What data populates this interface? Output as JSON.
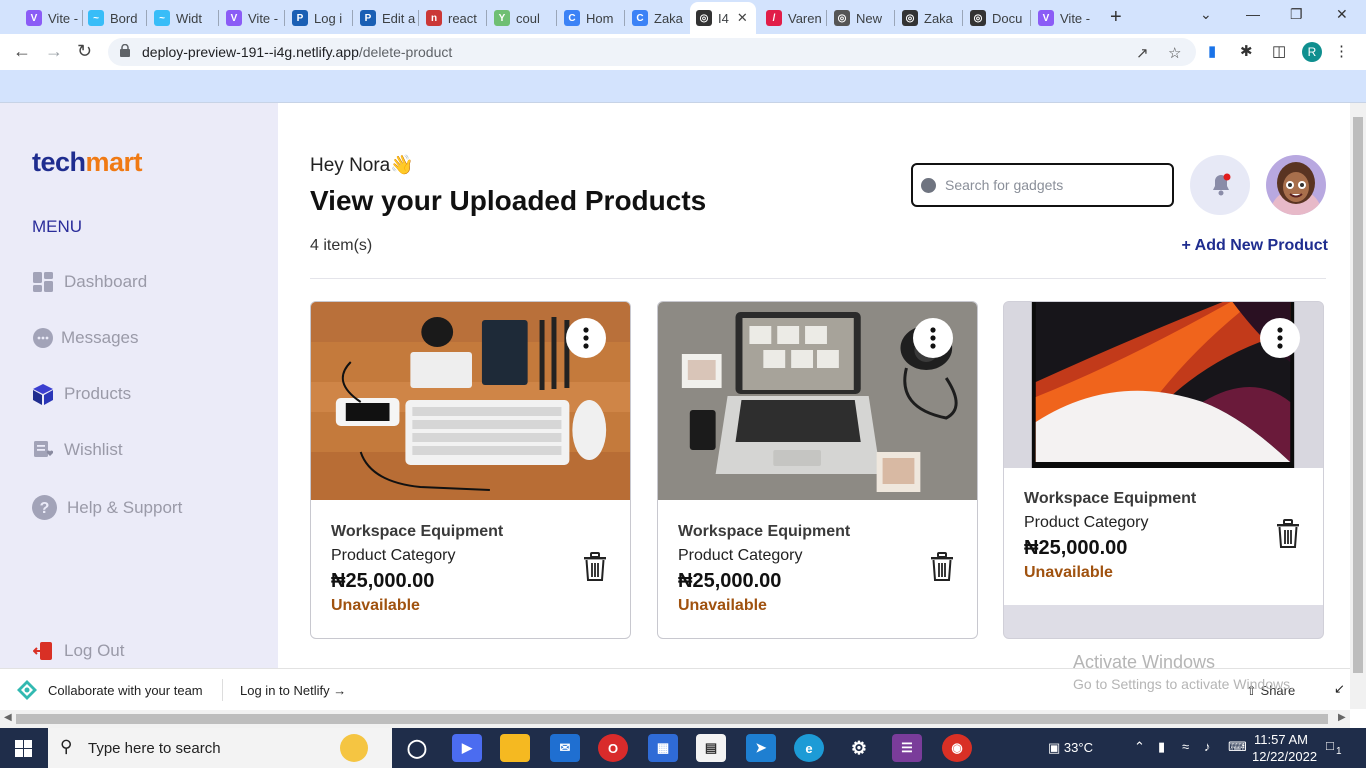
{
  "browser": {
    "tabs": [
      {
        "label": "Vite -",
        "color": "#8b5cf6",
        "glyph": "V"
      },
      {
        "label": "Bord",
        "color": "#38bdf8",
        "glyph": "~"
      },
      {
        "label": "Widt",
        "color": "#38bdf8",
        "glyph": "~"
      },
      {
        "label": "Vite -",
        "color": "#8b5cf6",
        "glyph": "V"
      },
      {
        "label": "Log i",
        "color": "#1a5fb4",
        "glyph": "P"
      },
      {
        "label": "Edit a",
        "color": "#1a5fb4",
        "glyph": "P"
      },
      {
        "label": "react",
        "color": "#cb3837",
        "glyph": "n"
      },
      {
        "label": "coul",
        "color": "#6fbf73",
        "glyph": "Y"
      },
      {
        "label": "Hom",
        "color": "#3b82f6",
        "glyph": "C"
      },
      {
        "label": "Zaka",
        "color": "#3b82f6",
        "glyph": "C"
      },
      {
        "label": "I4",
        "color": "#333333",
        "glyph": "◎",
        "active": true
      },
      {
        "label": "Varen",
        "color": "#e11d48",
        "glyph": "/"
      },
      {
        "label": "New",
        "color": "#555555",
        "glyph": "◎"
      },
      {
        "label": "Zaka",
        "color": "#333333",
        "glyph": "◎"
      },
      {
        "label": "Docu",
        "color": "#333333",
        "glyph": "◎"
      },
      {
        "label": "Vite -",
        "color": "#8b5cf6",
        "glyph": "V"
      }
    ],
    "url_host": "deploy-preview-191--i4g.netlify.app",
    "url_path": "/delete-product",
    "profile_initial": "R"
  },
  "sidebar": {
    "logo_part1": "tech",
    "logo_part2": "mart",
    "menu_label": "MENU",
    "items": [
      {
        "label": "Dashboard",
        "icon": "grid-icon"
      },
      {
        "label": "Messages",
        "icon": "chat-icon"
      },
      {
        "label": "Products",
        "icon": "cube-icon"
      },
      {
        "label": "Wishlist",
        "icon": "wishlist-icon"
      },
      {
        "label": "Help & Support",
        "icon": "help-icon"
      }
    ],
    "logout_label": "Log Out"
  },
  "header": {
    "greeting": "Hey Nora",
    "greeting_emoji": "👋",
    "title": "View your Uploaded Products",
    "item_count": "4 item(s)",
    "add_button": "+ Add New Product",
    "search_placeholder": "Search for gadgets"
  },
  "products": [
    {
      "name": "Workspace Equipment",
      "category": "Product Category",
      "price": "₦25,000.00",
      "status": "Unavailable",
      "image": "desk-flatlay"
    },
    {
      "name": "Workspace Equipment",
      "category": "Product Category",
      "price": "₦25,000.00",
      "status": "Unavailable",
      "image": "laptop-camera"
    },
    {
      "name": "Workspace Equipment",
      "category": "Product Category",
      "price": "₦25,000.00",
      "status": "Unavailable",
      "image": "macbook-wallpaper"
    }
  ],
  "netlify_bar": {
    "collaborate": "Collaborate with your team",
    "login": "Log in to Netlify",
    "share": "Share"
  },
  "activate_windows": {
    "line1": "Activate Windows",
    "line2": "Go to Settings to activate Windows."
  },
  "taskbar": {
    "search_text": "Type here to search",
    "temperature": "33°C",
    "time": "11:57 AM",
    "date": "12/22/2022",
    "notification_count": "1"
  }
}
